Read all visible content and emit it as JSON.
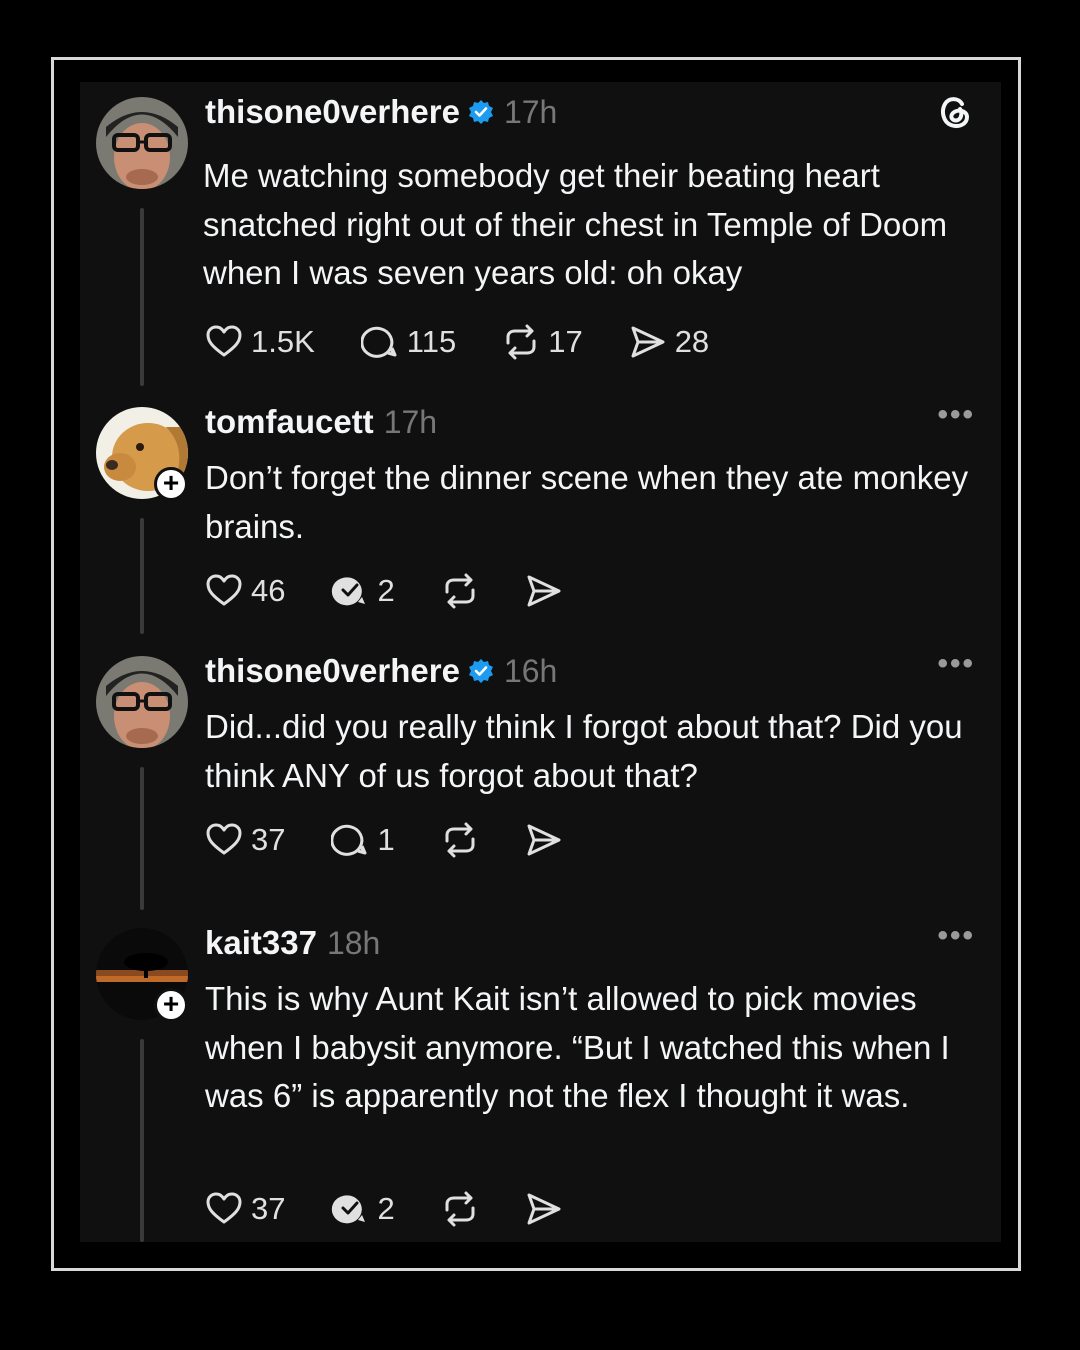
{
  "accent_color": "#1d9bf0",
  "app_icon": "threads-logo-icon",
  "posts": [
    {
      "username": "thisone0verhere",
      "verified": true,
      "time": "17h",
      "text": "Me watching somebody get their beating heart snatched right out of their chest in Temple of Doom when I was seven years old: oh okay",
      "likes": "1.5K",
      "replies": "115",
      "reposts": "17",
      "shares": "28"
    },
    {
      "username": "tomfaucett",
      "verified": false,
      "time": "17h",
      "text": "Don’t forget the dinner scene when they ate monkey brains.",
      "likes": "46",
      "replies": "2"
    },
    {
      "username": "thisone0verhere",
      "verified": true,
      "time": "16h",
      "text": "Did...did you really think I forgot about that? Did you think ANY of us forgot about that?",
      "likes": "37",
      "replies": "1"
    },
    {
      "username": "kait337",
      "verified": false,
      "time": "18h",
      "text": "This is why Aunt Kait isn’t allowed to pick movies when I babysit anymore. “But I watched this when I was 6” is apparently not the flex I thought it was.",
      "likes": "37",
      "replies": "2"
    }
  ]
}
